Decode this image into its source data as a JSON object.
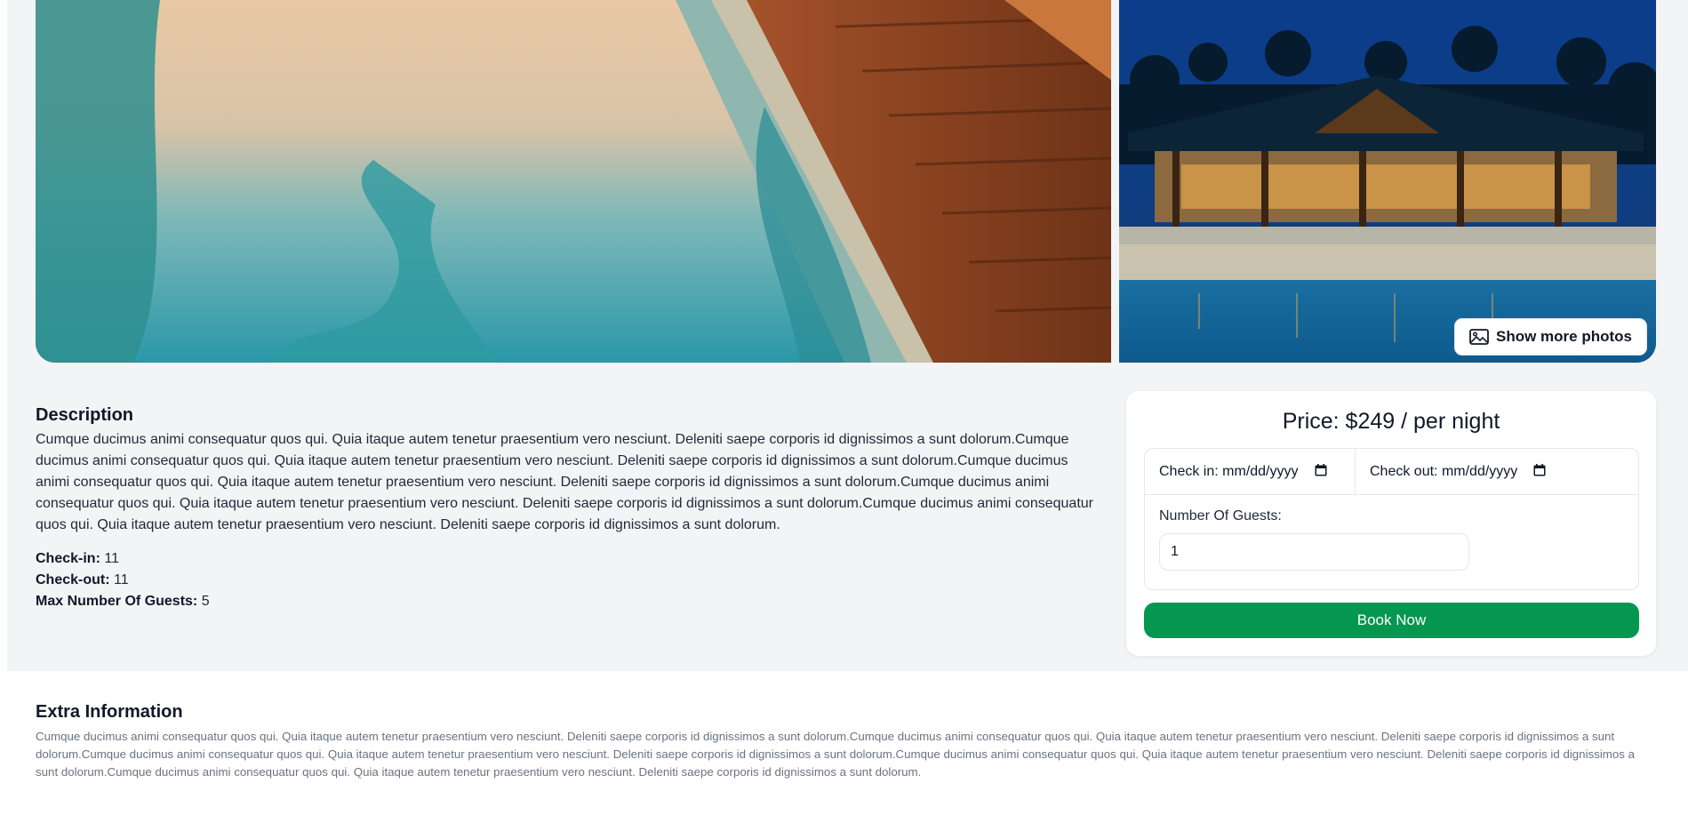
{
  "gallery": {
    "show_more_label": "Show more photos",
    "show_more_icon": "image-icon"
  },
  "description": {
    "heading": "Description",
    "text": "Cumque ducimus animi consequatur quos qui. Quia itaque autem tenetur praesentium vero nesciunt. Deleniti saepe corporis id dignissimos a sunt dolorum.Cumque ducimus animi consequatur quos qui. Quia itaque autem tenetur praesentium vero nesciunt. Deleniti saepe corporis id dignissimos a sunt dolorum.Cumque ducimus animi consequatur quos qui. Quia itaque autem tenetur praesentium vero nesciunt. Deleniti saepe corporis id dignissimos a sunt dolorum.Cumque ducimus animi consequatur quos qui. Quia itaque autem tenetur praesentium vero nesciunt. Deleniti saepe corporis id dignissimos a sunt dolorum.Cumque ducimus animi consequatur quos qui. Quia itaque autem tenetur praesentium vero nesciunt. Deleniti saepe corporis id dignissimos a sunt dolorum.",
    "checkin_label": "Check-in:",
    "checkin_value": "11",
    "checkout_label": "Check-out:",
    "checkout_value": "11",
    "max_guests_label": "Max Number Of Guests:",
    "max_guests_value": "5"
  },
  "booking": {
    "price": "Price: $249 / per night",
    "checkin_label": "Check in:",
    "checkin_placeholder": "mm/dd/yyyy",
    "checkout_label": "Check out:",
    "checkout_placeholder": "mm/dd/yyyy",
    "calendar_icon": "calendar-icon",
    "guests_label": "Number Of Guests:",
    "guests_value": "1",
    "button_label": "Book Now",
    "button_color": "#059650"
  },
  "extra": {
    "heading": "Extra Information",
    "text": "Cumque ducimus animi consequatur quos qui. Quia itaque autem tenetur praesentium vero nesciunt. Deleniti saepe corporis id dignissimos a sunt dolorum.Cumque ducimus animi consequatur quos qui. Quia itaque autem tenetur praesentium vero nesciunt. Deleniti saepe corporis id dignissimos a sunt dolorum.Cumque ducimus animi consequatur quos qui. Quia itaque autem tenetur praesentium vero nesciunt. Deleniti saepe corporis id dignissimos a sunt dolorum.Cumque ducimus animi consequatur quos qui. Quia itaque autem tenetur praesentium vero nesciunt. Deleniti saepe corporis id dignissimos a sunt dolorum.Cumque ducimus animi consequatur quos qui. Quia itaque autem tenetur praesentium vero nesciunt. Deleniti saepe corporis id dignissimos a sunt dolorum."
  }
}
